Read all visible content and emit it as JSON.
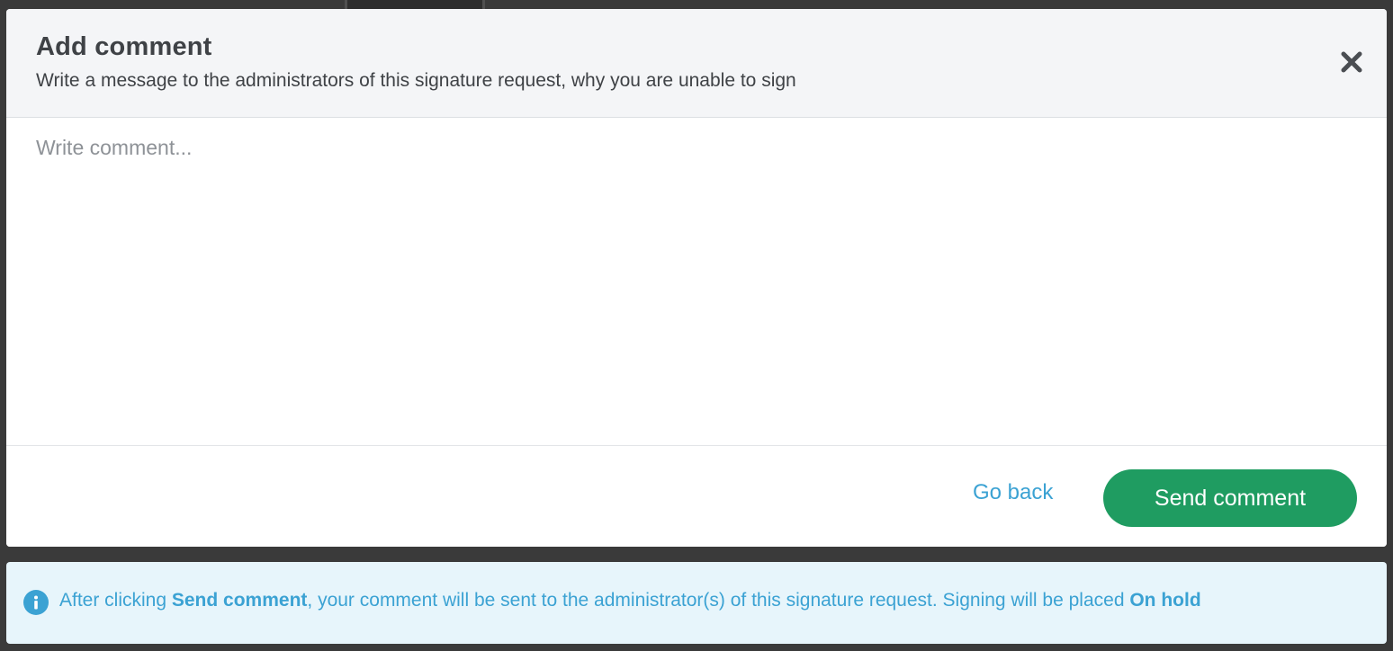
{
  "modal": {
    "title": "Add comment",
    "subtitle": "Write a message to the administrators of this signature request, why you are unable to sign",
    "close_icon": "close-icon",
    "comment_placeholder": "Write comment...",
    "comment_value": "",
    "go_back_label": "Go back",
    "send_label": "Send comment"
  },
  "info_banner": {
    "icon": "info-icon",
    "text_before": "After clicking ",
    "bold_action": "Send comment",
    "text_middle": ", your comment will be sent to the administrator(s) of this signature request. Signing will be placed ",
    "bold_status": "On hold"
  },
  "colors": {
    "accent_blue": "#3ba2d3",
    "primary_green": "#1f9c61",
    "header_bg": "#f4f5f7",
    "info_bg": "#e7f5fb",
    "backdrop": "#3a3a3a"
  }
}
